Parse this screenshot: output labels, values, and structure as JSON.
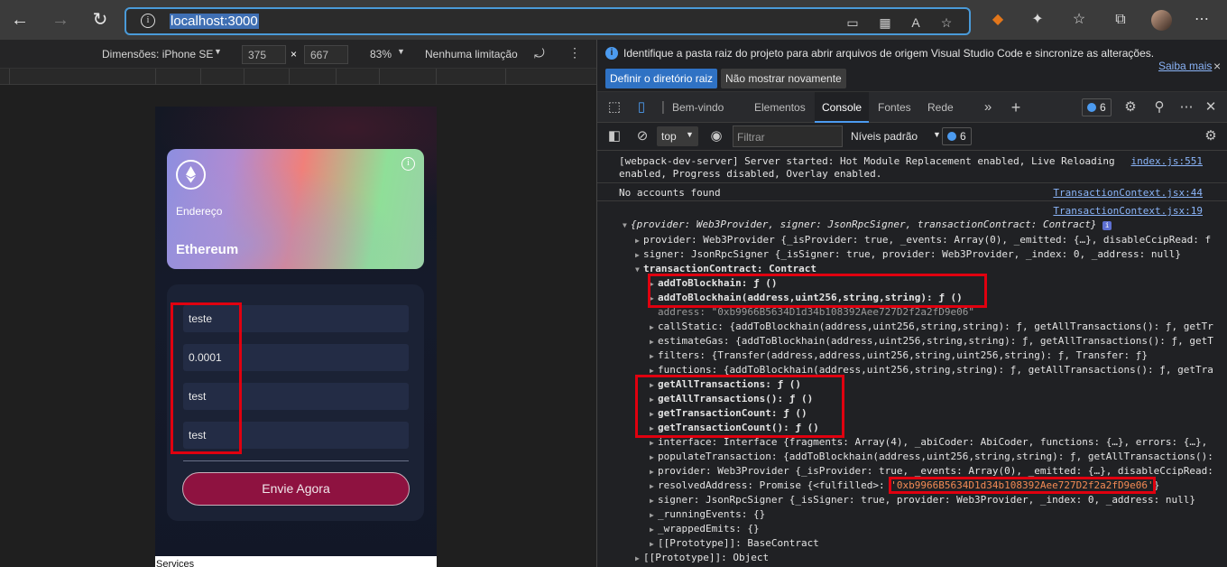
{
  "browser": {
    "url": "localhost:3000",
    "back_icon": "←",
    "forward_icon": "→",
    "reload_icon": "↻",
    "info_icon": "i",
    "more_icon": "⋯"
  },
  "device_toolbar": {
    "device_label": "Dimensões: iPhone SE",
    "width": "375",
    "times": "×",
    "height": "667",
    "zoom": "83%",
    "throttle": "Nenhuma limitação"
  },
  "app": {
    "card": {
      "label": "Endereço",
      "name": "Ethereum"
    },
    "form": {
      "field1": "teste",
      "field2": "0.0001",
      "field3": "test",
      "field4": "test",
      "submit_label": "Envie Agora"
    },
    "services_label": "Services"
  },
  "devtools": {
    "infobar": {
      "message": "Identifique a pasta raiz do projeto para abrir arquivos de origem Visual Studio Code e sincronize as alterações.",
      "learn_more": "Saiba mais",
      "primary_button": "Definir o diretório raiz",
      "secondary_button": "Não mostrar novamente",
      "close": "×"
    },
    "tabs": [
      "Bem-vindo",
      "Elementos",
      "Console",
      "Fontes",
      "Rede"
    ],
    "more_tabs": "»",
    "add_tab": "+",
    "issues_count": "6",
    "console_bar": {
      "context": "top",
      "filter_placeholder": "Filtrar",
      "levels": "Níveis padrão",
      "issues_count": "6"
    },
    "console": {
      "msg1_line1": "[webpack-dev-server] Server started: Hot Module Replacement enabled, Live Reloading",
      "msg1_line2": "enabled, Progress disabled, Overlay enabled.",
      "msg1_src": "index.js:551",
      "msg2": "No accounts found",
      "msg2_src": "TransactionContext.jsx:44",
      "msg3_src": "TransactionContext.jsx:19",
      "obj_summary": "{provider: Web3Provider, signer: JsonRpcSigner, transactionContract: Contract}",
      "l_provider": "provider: Web3Provider {_isProvider: true, _events: Array(0), _emitted: {…}, disableCcipRead: f",
      "l_signer": "signer: JsonRpcSigner {_isSigner: true, provider: Web3Provider, _index: 0, _address: null}",
      "l_tc": "transactionContract: Contract",
      "l_add1": "addToBlockhain: ƒ ()",
      "l_add2": "addToBlockhain(address,uint256,string,string): ƒ ()",
      "l_address": "address: \"0xb9966B5634D1d34b108392Aee727D2f2a2fD9e06\"",
      "l_callstatic": "callStatic: {addToBlockhain(address,uint256,string,string): ƒ, getAllTransactions(): ƒ, getTr",
      "l_estimate": "estimateGas: {addToBlockhain(address,uint256,string,string): ƒ, getAllTransactions(): ƒ, getT",
      "l_filters": "filters: {Transfer(address,address,uint256,string,uint256,string): ƒ, Transfer: ƒ}",
      "l_functions": "functions: {addToBlockhain(address,uint256,string,string): ƒ, getAllTransactions(): ƒ, getTra",
      "l_get1": "getAllTransactions: ƒ ()",
      "l_get2": "getAllTransactions(): ƒ ()",
      "l_get3": "getTransactionCount: ƒ ()",
      "l_get4": "getTransactionCount(): ƒ ()",
      "l_interface": "interface: Interface {fragments: Array(4), _abiCoder: AbiCoder, functions: {…}, errors: {…},",
      "l_populate": "populateTransaction: {addToBlockhain(address,uint256,string,string): ƒ, getAllTransactions():",
      "l_provider2": "provider: Web3Provider {_isProvider: true, _events: Array(0), _emitted: {…}, disableCcipRead:",
      "l_resolved_prefix": "resolvedAddress: Promise {<fulfilled>: ",
      "l_resolved_value": "'0xb9966B5634D1d34b108392Aee727D2f2a2fD9e06'",
      "l_resolved_suffix": "}",
      "l_signer2": "signer: JsonRpcSigner {_isSigner: true, provider: Web3Provider, _index: 0, _address: null}",
      "l_running": "_runningEvents: {}",
      "l_wrapped": "_wrappedEmits: {}",
      "l_proto1": "[[Prototype]]: BaseContract",
      "l_proto2": "[[Prototype]]: Object"
    }
  },
  "colors": {
    "highlight": "#e0000f",
    "accent": "#4c9bf0",
    "button": "#8e1240"
  }
}
